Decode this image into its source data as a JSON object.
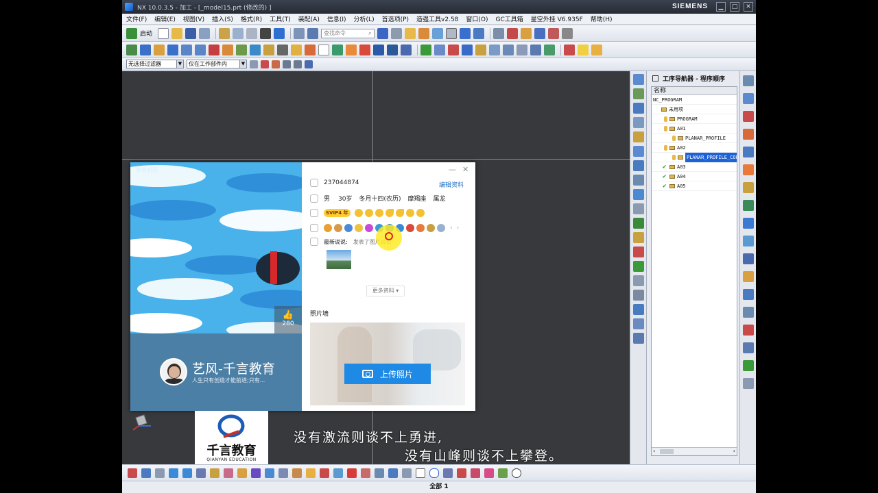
{
  "window": {
    "title": "NX 10.0.3.5 - 加工 - [_model15.prt  (修改的) ]",
    "brand": "SIEMENS",
    "minimize": "▁",
    "maximize": "□",
    "close": "✕"
  },
  "menu": [
    "文件(F)",
    "编辑(E)",
    "视图(V)",
    "插入(S)",
    "格式(R)",
    "工具(T)",
    "装配(A)",
    "信息(I)",
    "分析(L)",
    "首选项(P)",
    "造强工具v2.58",
    "窗口(O)",
    "GC工具箱",
    "星空外挂 V6.935F",
    "帮助(H)"
  ],
  "toolbar": {
    "start_label": "启动",
    "search_placeholder": "查找命令",
    "filter_select": "无选择过滤器",
    "scope_select": "仅在工作部件内"
  },
  "navigator": {
    "title": "工序导航器 - 程序顺序",
    "column": "名称",
    "rows": [
      {
        "label": "NC_PROGRAM",
        "depth": 0,
        "icon": "none"
      },
      {
        "label": "未用项",
        "depth": 1,
        "icon": "folder"
      },
      {
        "label": "PROGRAM",
        "depth": 1,
        "icon": "key-folder"
      },
      {
        "label": "A01",
        "depth": 1,
        "icon": "key-folder"
      },
      {
        "label": "PLANAR_PROFILE",
        "depth": 2,
        "icon": "key-op"
      },
      {
        "label": "A02",
        "depth": 1,
        "icon": "key-folder"
      },
      {
        "label": "PLANAR_PROFILE_COPY",
        "depth": 2,
        "icon": "key-op",
        "selected": true
      },
      {
        "label": "A03",
        "depth": 1,
        "icon": "check-folder"
      },
      {
        "label": "A04",
        "depth": 1,
        "icon": "check-folder"
      },
      {
        "label": "A05",
        "depth": 1,
        "icon": "check-folder"
      }
    ]
  },
  "profile": {
    "cover_label": "更换封面",
    "likes": "280",
    "qq": "237044874",
    "edit_label": "编辑资料",
    "gender": "男",
    "age": "30岁",
    "birthday": "冬月十四(农历)",
    "zodiac": "摩羯座",
    "zodiac_cn": "属龙",
    "svip": "SVIP4 年",
    "latest_label": "最新说说:",
    "latest_text": "发表了图片说说",
    "more_label": "更多资料",
    "photo_wall": "照片墙",
    "upload_label": "上传照片",
    "nickname": "艺风-千言教育",
    "signature": "人生只有创造才能前进;只有..."
  },
  "logo": {
    "cn": "千言教育",
    "en": "QIANYAN EDUCATION"
  },
  "subtitles": {
    "line1": "没有激流则谈不上勇进,",
    "line2": "没有山峰则谈不上攀登。"
  },
  "status": {
    "text": "全部 1"
  },
  "colors": {
    "accent": "#1f8ae6",
    "cover": "#49b2ea",
    "namebar": "#4c7fa6",
    "selection": "#1e63d6"
  }
}
